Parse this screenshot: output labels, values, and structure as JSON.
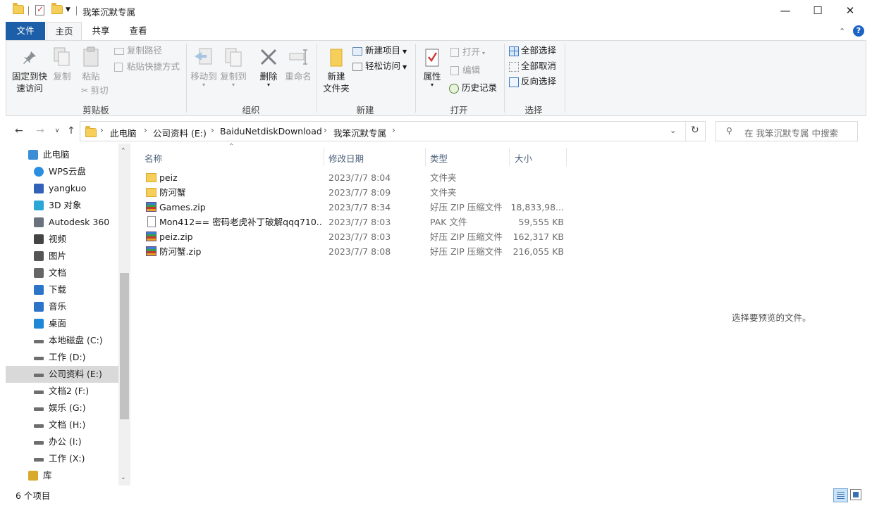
{
  "window": {
    "title": "我笨沉默专属"
  },
  "ribbon_tabs": [
    "文件",
    "主页",
    "共享",
    "查看"
  ],
  "ribbon": {
    "clipboard": {
      "pin": "固定到快\n速访问",
      "copy": "复制",
      "paste": "粘贴",
      "copy_path": "复制路径",
      "paste_shortcut": "粘贴快捷方式",
      "cut": "剪切",
      "label": "剪贴板"
    },
    "organize": {
      "move_to": "移动到",
      "copy_to": "复制到",
      "delete": "删除",
      "rename": "重命名",
      "label": "组织"
    },
    "new": {
      "new_folder": "新建\n文件夹",
      "new_item": "新建项目",
      "easy_access": "轻松访问",
      "label": "新建"
    },
    "open": {
      "properties": "属性",
      "open": "打开",
      "edit": "编辑",
      "history": "历史记录",
      "label": "打开"
    },
    "select": {
      "select_all": "全部选择",
      "select_none": "全部取消",
      "invert": "反向选择",
      "label": "选择"
    }
  },
  "address": {
    "crumbs": [
      "此电脑",
      "公司资料 (E:)",
      "BaiduNetdiskDownload",
      "我笨沉默专属"
    ]
  },
  "search": {
    "placeholder": "在 我笨沉默专属 中搜索"
  },
  "sidebar": {
    "items": [
      {
        "label": "此电脑",
        "icon": "computer-icon"
      },
      {
        "label": "WPS云盘",
        "icon": "cloud-icon"
      },
      {
        "label": "yangkuo",
        "icon": "user-icon"
      },
      {
        "label": "3D 对象",
        "icon": "cube-icon"
      },
      {
        "label": "Autodesk 360",
        "icon": "autodesk-icon"
      },
      {
        "label": "视频",
        "icon": "video-icon"
      },
      {
        "label": "图片",
        "icon": "pictures-icon"
      },
      {
        "label": "文档",
        "icon": "documents-icon"
      },
      {
        "label": "下载",
        "icon": "download-icon"
      },
      {
        "label": "音乐",
        "icon": "music-icon"
      },
      {
        "label": "桌面",
        "icon": "desktop-icon"
      },
      {
        "label": "本地磁盘 (C:)",
        "icon": "drive-icon"
      },
      {
        "label": "工作 (D:)",
        "icon": "drive-icon"
      },
      {
        "label": "公司资料 (E:)",
        "icon": "drive-icon"
      },
      {
        "label": "文档2 (F:)",
        "icon": "drive-icon"
      },
      {
        "label": "娱乐 (G:)",
        "icon": "drive-icon"
      },
      {
        "label": "文档 (H:)",
        "icon": "drive-icon"
      },
      {
        "label": "办公 (I:)",
        "icon": "drive-icon"
      },
      {
        "label": "工作 (X:)",
        "icon": "drive-icon"
      },
      {
        "label": "库",
        "icon": "library-icon"
      }
    ]
  },
  "columns": {
    "name": "名称",
    "date": "修改日期",
    "type": "类型",
    "size": "大小"
  },
  "files": [
    {
      "name": "peiz",
      "date": "2023/7/7 8:04",
      "type": "文件夹",
      "size": "",
      "icon": "folder-icon"
    },
    {
      "name": "防河蟹",
      "date": "2023/7/7 8:09",
      "type": "文件夹",
      "size": "",
      "icon": "folder-icon"
    },
    {
      "name": "Games.zip",
      "date": "2023/7/7 8:34",
      "type": "好压 ZIP 压缩文件",
      "size": "18,833,98...",
      "icon": "zip-icon"
    },
    {
      "name": "Mon412== 密码老虎补丁破解qqq710...",
      "date": "2023/7/7 8:03",
      "type": "PAK 文件",
      "size": "59,555 KB",
      "icon": "file-icon"
    },
    {
      "name": "peiz.zip",
      "date": "2023/7/7 8:03",
      "type": "好压 ZIP 压缩文件",
      "size": "162,317 KB",
      "icon": "zip-icon"
    },
    {
      "name": "防河蟹.zip",
      "date": "2023/7/7 8:08",
      "type": "好压 ZIP 压缩文件",
      "size": "216,055 KB",
      "icon": "zip-icon"
    }
  ],
  "preview": {
    "text": "选择要预览的文件。"
  },
  "status": {
    "count": "6 个项目"
  }
}
